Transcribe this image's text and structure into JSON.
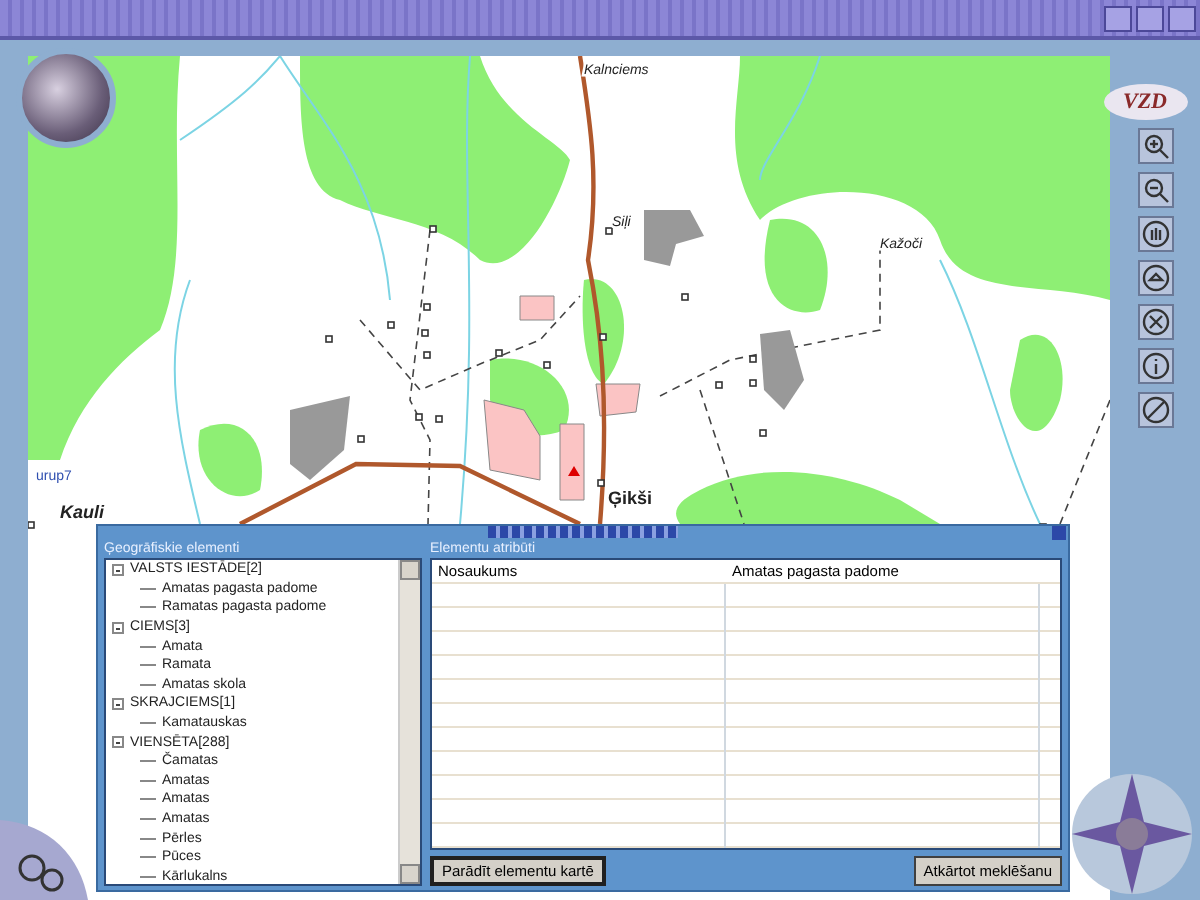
{
  "logo": {
    "text": "VZD"
  },
  "map": {
    "labels": [
      "Kalnciems",
      "Siļi",
      "Kažoči",
      "urup7",
      "Ģikši",
      "Kauli"
    ]
  },
  "dialog": {
    "tree_panel": {
      "title": "Ģeogrāfiskie elementi",
      "items": [
        {
          "label": "VALSTS IESTĀDE[2]",
          "expanded": true,
          "children": [
            {
              "label": "Amatas pagasta padome"
            },
            {
              "label": "Ramatas pagasta padome"
            }
          ]
        },
        {
          "label": "CIEMS[3]",
          "expanded": true,
          "children": [
            {
              "label": "Amata"
            },
            {
              "label": "Ramata"
            },
            {
              "label": "Amatas skola"
            }
          ]
        },
        {
          "label": "SKRAJCIEMS[1]",
          "expanded": true,
          "children": [
            {
              "label": "Kamatauskas"
            }
          ]
        },
        {
          "label": "VIENSĒTA[288]",
          "expanded": true,
          "children": [
            {
              "label": "Čamatas"
            },
            {
              "label": "Amatas"
            },
            {
              "label": "Amatas"
            },
            {
              "label": "Amatas"
            },
            {
              "label": "Pērles"
            },
            {
              "label": "Pūces"
            },
            {
              "label": "Kārlukalns"
            }
          ]
        }
      ]
    },
    "attributes_panel": {
      "title": "Elementu atribūti",
      "columns": [
        "Nosaukums",
        "Amatas pagasta padome"
      ],
      "buttons": [
        "Parādīt elementu kartē",
        "Atkārtot meklēšanu"
      ]
    }
  }
}
